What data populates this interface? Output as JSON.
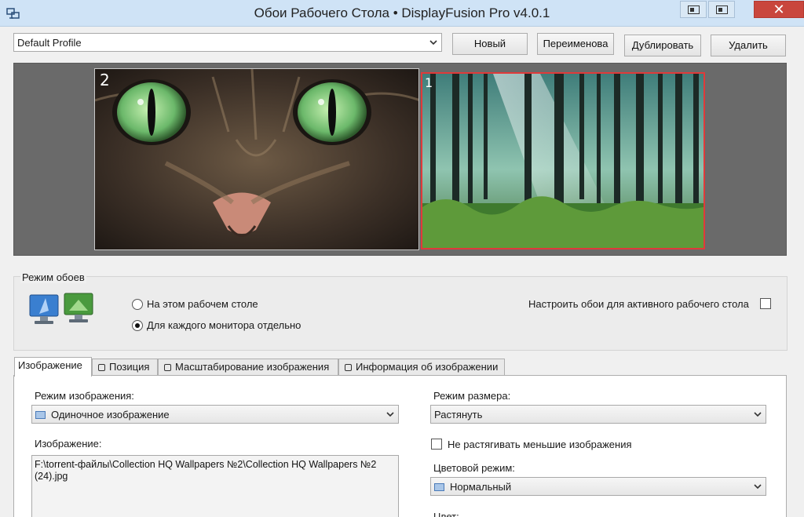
{
  "window": {
    "title": "Обои Рабочего Стола • DisplayFusion Pro v4.0.1",
    "close_glyph": "✕"
  },
  "profile": {
    "selected": "Default Profile",
    "buttons": {
      "new": "Новый",
      "rename": "Переименова",
      "duplicate": "Дублировать",
      "delete": "Удалить"
    }
  },
  "preview": {
    "monitors": [
      {
        "number": "2",
        "selected": false
      },
      {
        "number": "1",
        "selected": true
      }
    ]
  },
  "wallpaper_mode": {
    "group_label": "Режим обоев",
    "options": [
      {
        "label": "На этом рабочем столе",
        "checked": false
      },
      {
        "label": "Для каждого монитора отдельно",
        "checked": true
      }
    ],
    "active_desktop_label": "Настроить обои для активного рабочего стола",
    "active_desktop_checked": false
  },
  "tabs": [
    {
      "label": "Изображение",
      "active": true
    },
    {
      "label": "Позиция",
      "active": false
    },
    {
      "label": "Масштабирование изображения",
      "active": false
    },
    {
      "label": "Информация об изображении",
      "active": false
    }
  ],
  "image_tab": {
    "image_mode_label": "Режим изображения:",
    "image_mode_value": "Одиночное изображение",
    "image_label": "Изображение:",
    "image_path": "F:\\torrent-файлы\\Collection HQ Wallpapers №2\\Collection HQ Wallpapers №2 (24).jpg",
    "size_mode_label": "Режим размера:",
    "size_mode_value": "Растянуть",
    "no_stretch_label": "Не растягивать меньшие изображения",
    "no_stretch_checked": false,
    "color_mode_label": "Цветовой режим:",
    "color_mode_value": "Нормальный",
    "color_label": "Цвет:"
  },
  "colors": {
    "titlebar": "#cfe3f6",
    "close_button": "#c9463d",
    "selected_monitor_border": "#e03a3a"
  }
}
